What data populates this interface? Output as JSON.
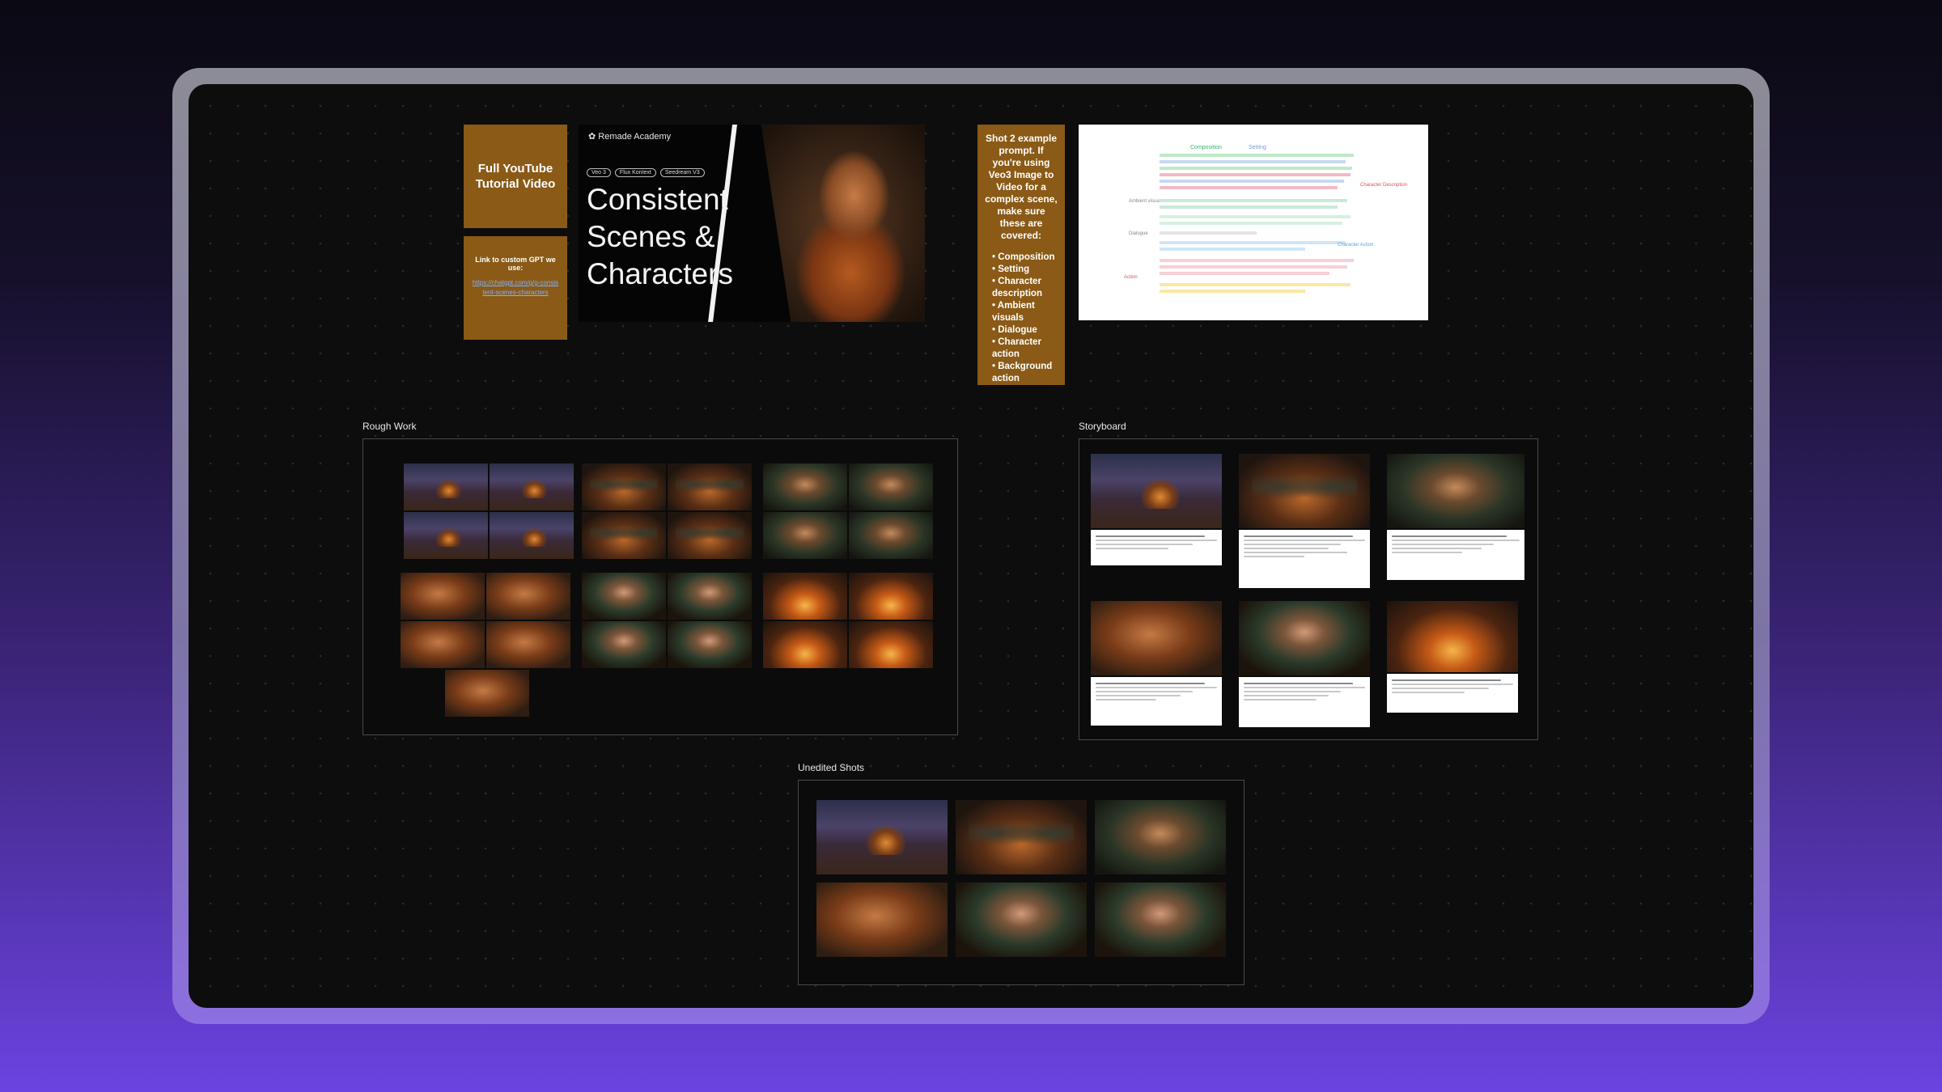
{
  "notes": {
    "youtube": "Full YouTube Tutorial Video",
    "gpt_label": "Link to custom GPT we use:",
    "gpt_link": "https://chatgpt.com/g/g-consistent-scenes-characters",
    "shot_intro": "Shot 2 example prompt. If you're using Veo3 Image to Video for a complex scene, make sure these are covered:",
    "shot_items": [
      "Composition",
      "Setting",
      "Character description",
      "Ambient visuals",
      "Dialogue",
      "Character action",
      "Background action"
    ]
  },
  "thumbnail": {
    "brand": "Remade Academy",
    "pills": [
      "Veo 3",
      "Flux Kontext",
      "Seedream V3"
    ],
    "title": "Consistent Scenes & Characters"
  },
  "doc": {
    "labels": [
      "Composition",
      "Setting",
      "Character Description",
      "Ambient visuals",
      "Dialogue",
      "Character Action",
      "Action"
    ]
  },
  "sections": {
    "rough_work": "Rough Work",
    "storyboard": "Storyboard",
    "unedited_shots": "Unedited Shots"
  },
  "colors": {
    "note_bg": "#8a5a16",
    "canvas_bg": "#0d0d0d",
    "frame": "#8c8c96"
  }
}
